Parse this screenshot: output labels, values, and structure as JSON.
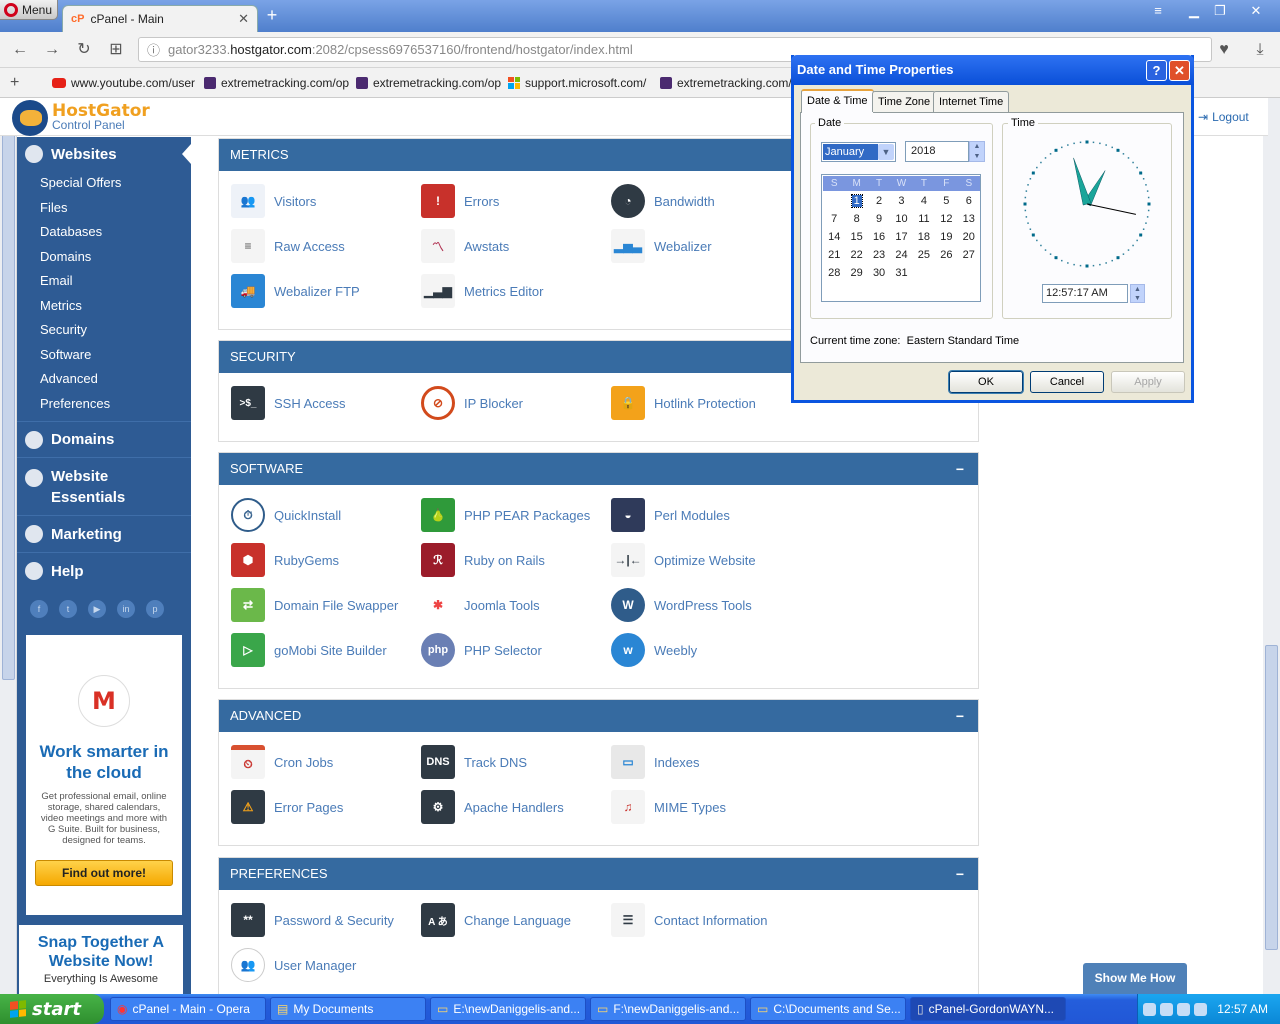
{
  "browser": {
    "menu_label": "Menu",
    "tab_title": "cPanel - Main",
    "url_prefix": "gator3233.",
    "url_host": "hostgator.com",
    "url_rest": ":2082/cpsess6976537160/frontend/hostgator/index.html",
    "bookmarks": [
      {
        "label": "www.youtube.com/user",
        "icon": "youtube-icon"
      },
      {
        "label": "extremetracking.com/op",
        "icon": "extremetracking-icon"
      },
      {
        "label": "extremetracking.com/op",
        "icon": "extremetracking-icon"
      },
      {
        "label": "support.microsoft.com/",
        "icon": "microsoft-icon"
      },
      {
        "label": "extremetracking.com/f",
        "icon": "extremetracking-icon"
      }
    ]
  },
  "header": {
    "brand_name": "HostGator",
    "brand_sub": "Control Panel",
    "logout_label": "Logout"
  },
  "sidebar": {
    "active_section": "Websites",
    "sub_items": [
      "Special Offers",
      "Files",
      "Databases",
      "Domains",
      "Email",
      "Metrics",
      "Security",
      "Software",
      "Advanced",
      "Preferences"
    ],
    "sections": [
      "Domains",
      "Website Essentials",
      "Marketing",
      "Help"
    ],
    "social": [
      "facebook-icon",
      "twitter-icon",
      "youtube-icon",
      "linkedin-icon",
      "pinterest-icon"
    ]
  },
  "promo": {
    "icon_letter": "M",
    "headline": "Work smarter in the cloud",
    "body": "Get professional email, online storage, shared calendars, video meetings and more with G Suite. Built for business, designed for teams.",
    "button": "Find out more!",
    "promo2_headline": "Snap Together A Website Now!",
    "promo2_sub": "Everything Is Awesome"
  },
  "panels": {
    "metrics": {
      "title": "METRICS",
      "items": [
        "Visitors",
        "Errors",
        "Bandwidth",
        "Raw Access",
        "Awstats",
        "Webalizer",
        "Webalizer FTP",
        "Metrics Editor"
      ]
    },
    "security": {
      "title": "SECURITY",
      "items": [
        "SSH Access",
        "IP Blocker",
        "Hotlink Protection"
      ]
    },
    "software": {
      "title": "SOFTWARE",
      "collapse": "−",
      "items": [
        "QuickInstall",
        "PHP PEAR Packages",
        "Perl Modules",
        "RubyGems",
        "Ruby on Rails",
        "Optimize Website",
        "Domain File Swapper",
        "Joomla Tools",
        "WordPress Tools",
        "goMobi Site Builder",
        "PHP Selector",
        "Weebly"
      ]
    },
    "advanced": {
      "title": "ADVANCED",
      "collapse": "−",
      "items": [
        "Cron Jobs",
        "Track DNS",
        "Indexes",
        "Error Pages",
        "Apache Handlers",
        "MIME Types"
      ]
    },
    "preferences": {
      "title": "PREFERENCES",
      "collapse": "−",
      "items": [
        "Password & Security",
        "Change Language",
        "Contact Information",
        "User Manager"
      ]
    }
  },
  "icon_glyphs": {
    "ssh": ">$_",
    "dns": "DNS",
    "php": "php",
    "password": "**",
    "language": "A あ"
  },
  "show_me_how": "Show Me How",
  "dialog": {
    "title": "Date and Time Properties",
    "help": "?",
    "close": "✕",
    "tabs": [
      "Date & Time",
      "Time Zone",
      "Internet Time"
    ],
    "date_group": "Date",
    "time_group": "Time",
    "month": "January",
    "year": "2018",
    "weekdays": [
      "S",
      "M",
      "T",
      "W",
      "T",
      "F",
      "S"
    ],
    "first_weekday_offset": 1,
    "days_in_month": 31,
    "selected_day": 1,
    "time": "12:57:17 AM",
    "clock": {
      "hour": 12,
      "minute": 57,
      "second": 17
    },
    "timezone_label": "Current time zone:",
    "timezone": "Eastern Standard Time",
    "ok": "OK",
    "cancel": "Cancel",
    "apply": "Apply"
  },
  "taskbar": {
    "start": "start",
    "items": [
      "cPanel - Main - Opera",
      "My Documents",
      "E:\\newDaniggelis-and...",
      "F:\\newDaniggelis-and...",
      "C:\\Documents and Se...",
      "cPanel-GordonWAYN..."
    ],
    "clock": "12:57 AM"
  }
}
